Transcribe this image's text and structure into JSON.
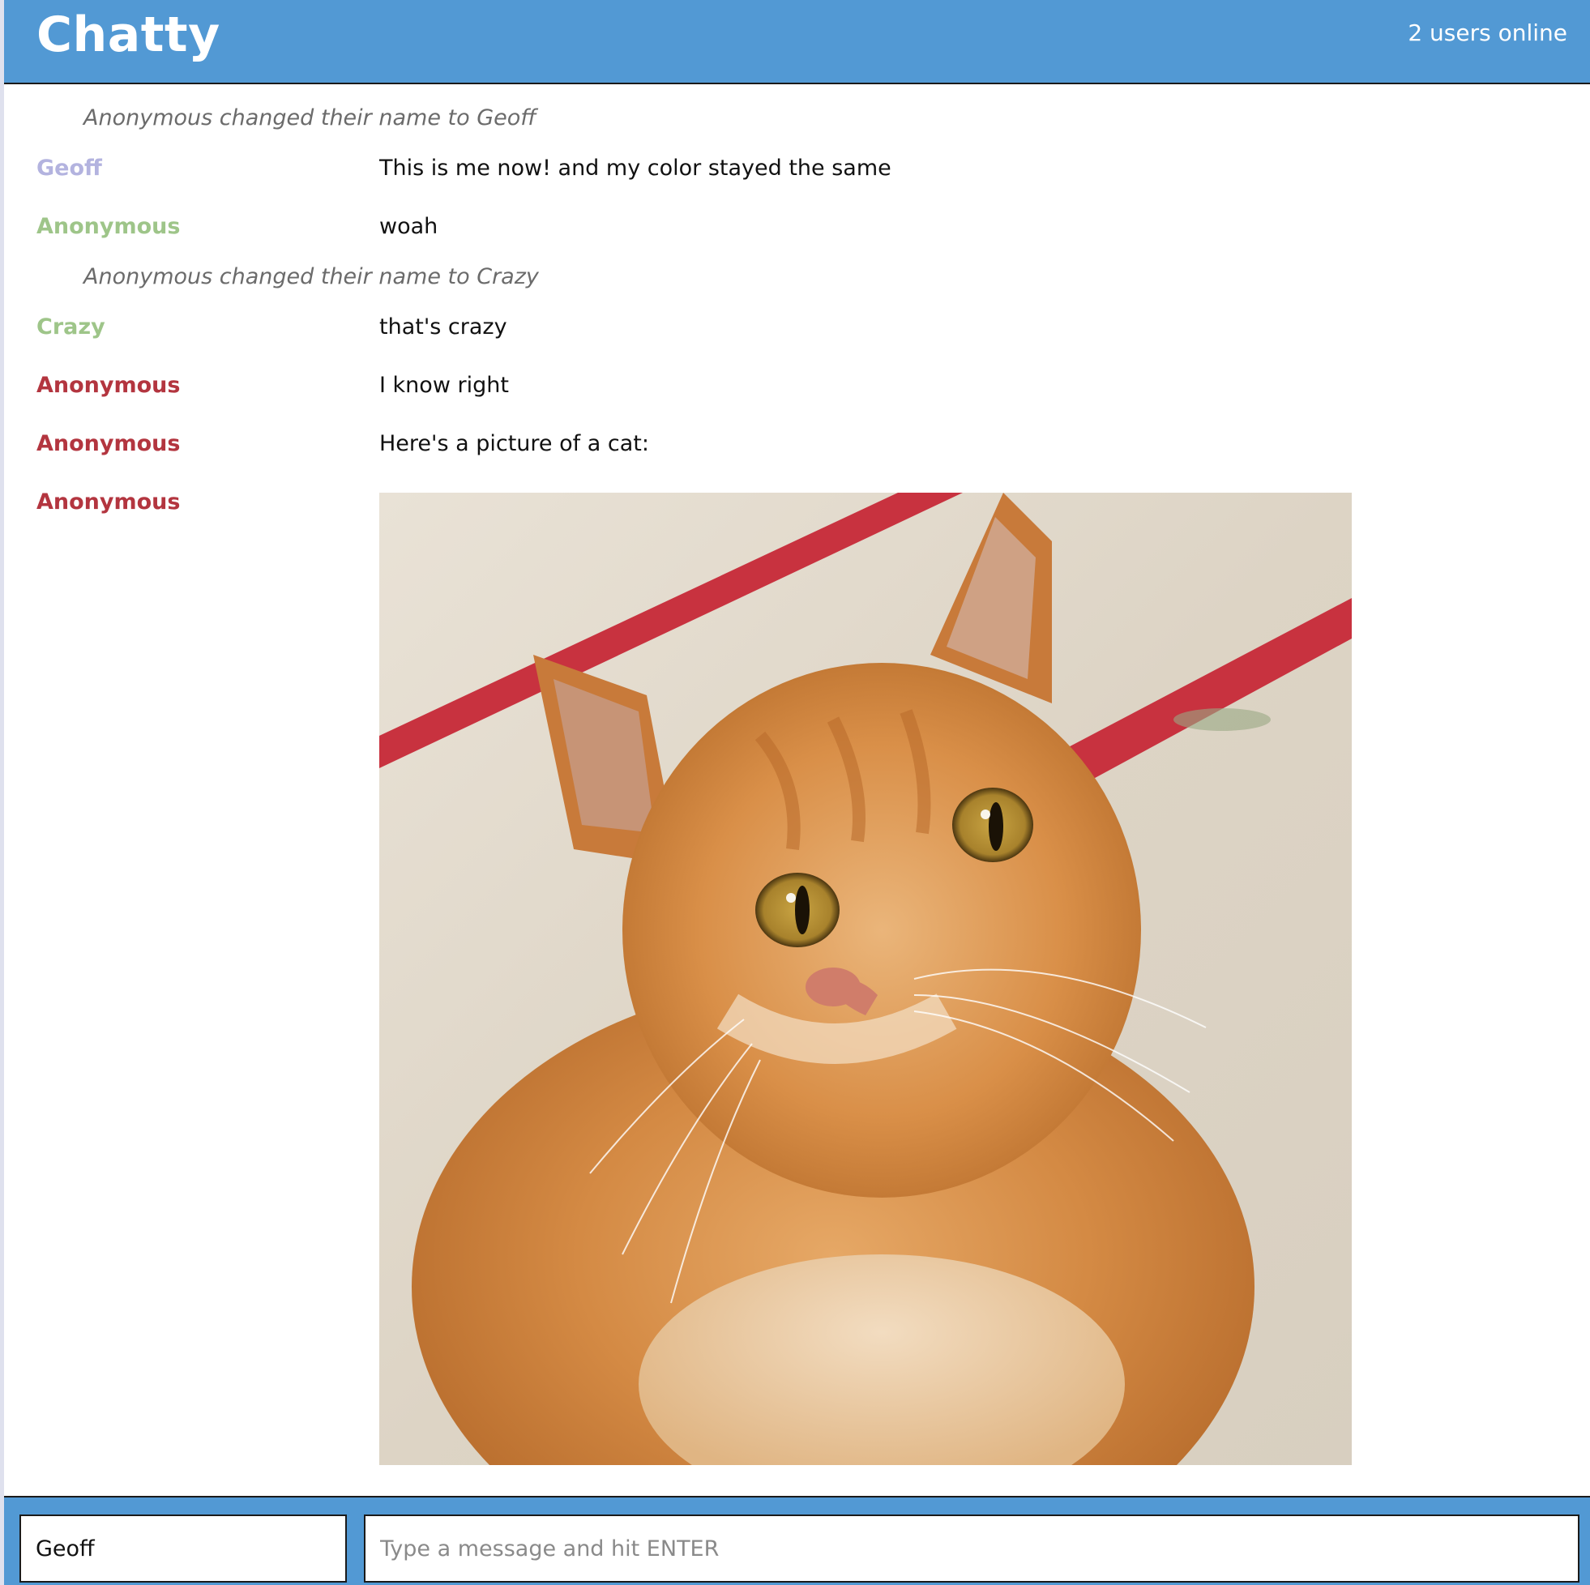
{
  "header": {
    "title": "Chatty",
    "users_online": "2 users online"
  },
  "messages": [
    {
      "type": "system",
      "text": "Anonymous changed their name to Geoff"
    },
    {
      "type": "chat",
      "username": "Geoff",
      "color": "#b3b3df",
      "text": "This is me now! and my color stayed the same"
    },
    {
      "type": "chat",
      "username": "Anonymous",
      "color": "#9ec589",
      "text": "woah"
    },
    {
      "type": "system",
      "text": "Anonymous changed their name to Crazy"
    },
    {
      "type": "chat",
      "username": "Crazy",
      "color": "#9ec589",
      "text": "that's crazy"
    },
    {
      "type": "chat",
      "username": "Anonymous",
      "color": "#b3353f",
      "text": "I know right"
    },
    {
      "type": "chat",
      "username": "Anonymous",
      "color": "#b3353f",
      "text": "Here's a picture of a cat:"
    },
    {
      "type": "image",
      "username": "Anonymous",
      "color": "#b3353f",
      "image": "orange-tabby-cat-photo"
    }
  ],
  "chatbar": {
    "name_value": "Geoff",
    "message_placeholder": "Type a message and hit ENTER"
  },
  "colors": {
    "accent": "#5299d4",
    "system_text": "#6b6b6b"
  }
}
